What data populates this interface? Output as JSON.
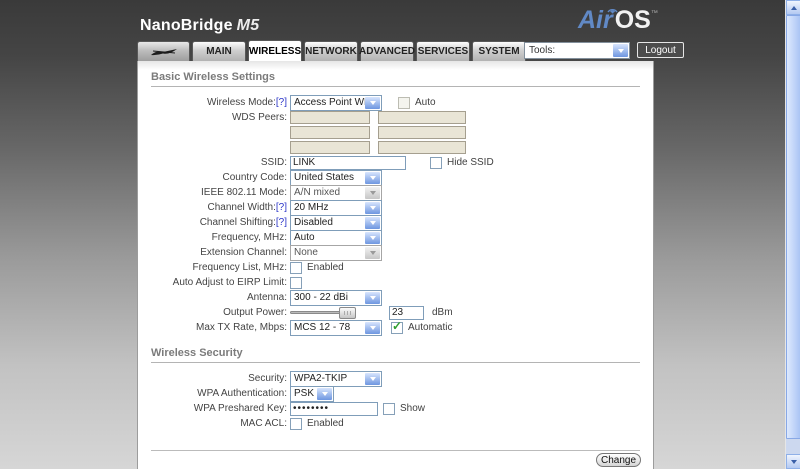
{
  "header": {
    "brand": "NanoBridge",
    "model": "M5",
    "logo": {
      "air": "Air",
      "os": "OS",
      "tm": "™"
    },
    "tools_select": "Tools:",
    "logout": "Logout"
  },
  "tabs": [
    {
      "label": "MAIN"
    },
    {
      "label": "WIRELESS",
      "active": true
    },
    {
      "label": "NETWORK"
    },
    {
      "label": "ADVANCED"
    },
    {
      "label": "SERVICES"
    },
    {
      "label": "SYSTEM"
    }
  ],
  "basic": {
    "title": "Basic Wireless Settings",
    "wireless_mode": {
      "label": "Wireless Mode:",
      "help": "[?]",
      "value": "Access Point WDS",
      "auto_label": "Auto",
      "auto_checked": false
    },
    "wds_peers": {
      "label": "WDS Peers:",
      "values": [
        "",
        "",
        "",
        "",
        "",
        ""
      ]
    },
    "ssid": {
      "label": "SSID:",
      "value": "LINK",
      "hide_label": "Hide SSID",
      "hide_checked": false
    },
    "country_code": {
      "label": "Country Code:",
      "value": "United States"
    },
    "ieee_mode": {
      "label": "IEEE 802.11 Mode:",
      "value": "A/N mixed",
      "disabled": true
    },
    "channel_width": {
      "label": "Channel Width:",
      "help": "[?]",
      "value": "20 MHz"
    },
    "channel_shifting": {
      "label": "Channel Shifting:",
      "help": "[?]",
      "value": "Disabled"
    },
    "frequency": {
      "label": "Frequency, MHz:",
      "value": "Auto"
    },
    "extension_channel": {
      "label": "Extension Channel:",
      "value": "None",
      "disabled": true
    },
    "frequency_list": {
      "label": "Frequency List, MHz:",
      "enabled_label": "Enabled",
      "checked": false
    },
    "eirp": {
      "label": "Auto Adjust to EIRP Limit:",
      "checked": false
    },
    "antenna": {
      "label": "Antenna:",
      "value": "300 - 22 dBi"
    },
    "output_power": {
      "label": "Output Power:",
      "value": "23",
      "unit": "dBm",
      "slider_percent": 100
    },
    "max_tx_rate": {
      "label": "Max TX Rate, Mbps:",
      "value": "MCS 12 - 78",
      "auto_label": "Automatic",
      "auto_checked": true,
      "check_glyph": "✓"
    }
  },
  "security": {
    "title": "Wireless Security",
    "security": {
      "label": "Security:",
      "value": "WPA2-TKIP"
    },
    "wpa_auth": {
      "label": "WPA Authentication:",
      "value": "PSK"
    },
    "wpa_key": {
      "label": "WPA Preshared Key:",
      "value": "••••••••",
      "show_label": "Show",
      "show_checked": false
    },
    "mac_acl": {
      "label": "MAC ACL:",
      "enabled_label": "Enabled",
      "checked": false
    }
  },
  "footer": {
    "change": "Change"
  },
  "colors": {
    "accent_blue": "#6189c5",
    "select_arrow_blue": "#6e96e0",
    "disabled_field_bg": "#e9e5d6",
    "check_green": "#2f9e2f",
    "section_title_gray": "#7b7b7b"
  }
}
